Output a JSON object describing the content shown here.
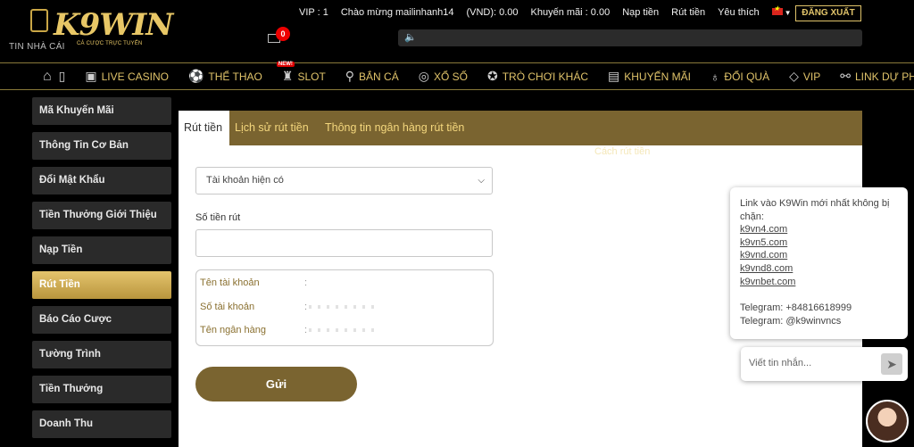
{
  "header": {
    "brand_tagline": "TIN NHÀ CÁI",
    "logo_text": "K9WIN",
    "logo_sub": "CÁ CƯỢC TRỰC TUYẾN",
    "vip": "VIP : 1",
    "greeting": "Chào mừng mailinhanh14",
    "balance": "(VND): 0.00",
    "promo_balance": "Khuyến mãi : 0.00",
    "deposit_link": "Nạp tiền",
    "withdraw_link": "Rút tiền",
    "favorites_link": "Yêu thích",
    "logout": "ĐĂNG XUẤT",
    "mail_count": "0"
  },
  "nav": {
    "items": [
      {
        "label": "LIVE CASINO",
        "icon": "casino-icon"
      },
      {
        "label": "THỂ THAO",
        "icon": "soccer-icon"
      },
      {
        "label": "SLOT",
        "icon": "slot-icon",
        "tag": "NEW!"
      },
      {
        "label": "BẮN CÁ",
        "icon": "fish-icon"
      },
      {
        "label": "XỔ SỐ",
        "icon": "lottery-icon"
      },
      {
        "label": "TRÒ CHƠI KHÁC",
        "icon": "game-icon"
      },
      {
        "label": "KHUYẾN MÃI",
        "icon": "gift-icon"
      },
      {
        "label": "ĐỔI QUÀ",
        "icon": "exchange-icon"
      },
      {
        "label": "VIP",
        "icon": "diamond-icon"
      },
      {
        "label": "LINK DỰ PHÒ",
        "icon": "link-icon"
      }
    ]
  },
  "sidebar": {
    "items": [
      {
        "label": "Mã Khuyến Mãi"
      },
      {
        "label": "Thông Tin Cơ Bản"
      },
      {
        "label": "Đổi Mật Khẩu"
      },
      {
        "label": "Tiền Thưởng Giới Thiệu"
      },
      {
        "label": "Nạp Tiền"
      },
      {
        "label": "Rút Tiền"
      },
      {
        "label": "Báo Cáo Cược"
      },
      {
        "label": "Tường Trình"
      },
      {
        "label": "Tiền Thưởng"
      },
      {
        "label": "Doanh Thu"
      }
    ],
    "active_index": 5
  },
  "panel": {
    "tabs": [
      "Rút tiền",
      "Lịch sử rút tiền",
      "Thông tin ngân hàng rút tiền"
    ],
    "help_link": "Cách rút tiền",
    "account_select": "Tài khoản hiện có",
    "amount_label": "Số tiền rút",
    "info": {
      "account_name": "Tên tài khoản",
      "account_number": "Số tài khoản",
      "bank_name": "Tên ngân hàng"
    },
    "submit": "Gửi"
  },
  "chat": {
    "intro": "Link vào K9Win mới nhất không bị chặn:",
    "links": [
      "k9vn4.com",
      "k9vn5.com",
      "k9vnd.com",
      "k9vnd8.com",
      "k9vnbet.com"
    ],
    "telegram_phone": "Telegram: +84816618999",
    "telegram_handle": "Telegram: @k9winvncs",
    "placeholder": "Viết tin nhắn..."
  }
}
